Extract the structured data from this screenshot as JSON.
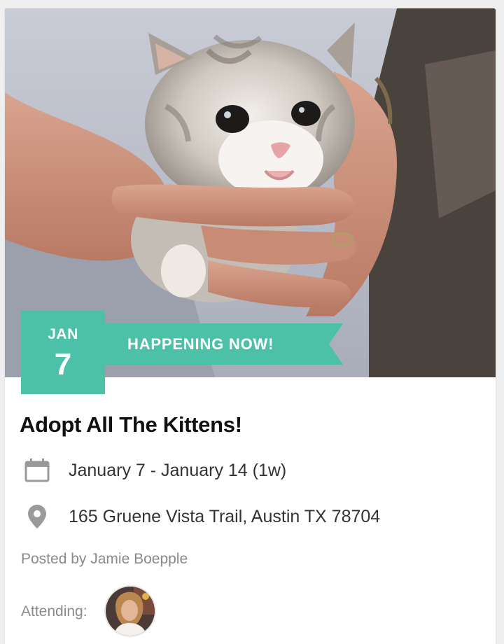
{
  "event": {
    "badge": {
      "month": "JAN",
      "day": "7"
    },
    "status_ribbon": "HAPPENING NOW!",
    "title": "Adopt All The Kittens!",
    "date_range": "January 7 - January 14 (1w)",
    "address": "165 Gruene Vista Trail, Austin TX 78704",
    "posted_by": "Posted by Jamie Boepple",
    "attending_label": "Attending:"
  },
  "icons": {
    "date": "calendar-icon",
    "location": "map-pin-icon"
  },
  "colors": {
    "accent": "#4cc1a8",
    "title_text": "#111111",
    "body_text": "#333333",
    "muted_text": "#8a8a8a",
    "icon_gray": "#9a9a9a"
  }
}
